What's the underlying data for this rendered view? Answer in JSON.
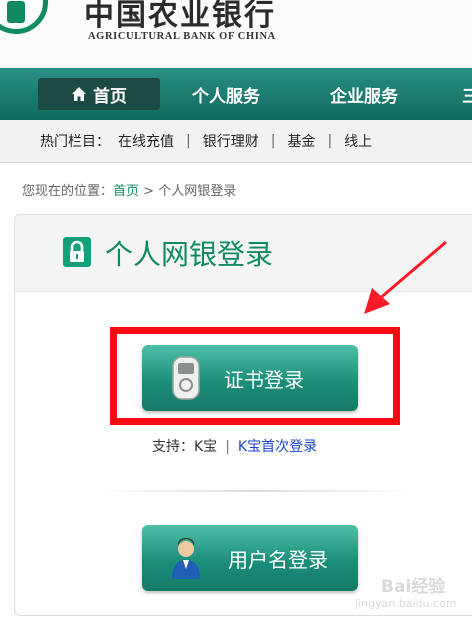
{
  "header": {
    "bank_name_cn": "中国农业银行",
    "bank_name_en": "AGRICULTURAL BANK OF CHINA"
  },
  "nav": {
    "home": "首页",
    "personal": "个人服务",
    "corporate": "企业服务",
    "next_cut": "三"
  },
  "hot_bar": {
    "label": "热门栏目：",
    "links": [
      "在线充值",
      "银行理财",
      "基金",
      "线上"
    ]
  },
  "breadcrumb": {
    "prefix": "您现在的位置：",
    "home": "首页",
    "arrow": ">",
    "current": "个人网银登录"
  },
  "panel": {
    "title": "个人网银登录"
  },
  "cert_login": {
    "label": "证书登录",
    "support_label": "支持：K宝",
    "separator": "|",
    "first_login_link": "K宝首次登录"
  },
  "username_login": {
    "label": "用户名登录"
  },
  "watermark": {
    "line1": "Bai经验",
    "line2": "jingyan.baidu.com"
  },
  "colors": {
    "brand_green": "#0f8a62",
    "nav_green": "#1b7d71",
    "annotation_red": "#ff0b14",
    "link_blue": "#1a45d0"
  },
  "icons": {
    "home": "house-icon",
    "lock": "lock-icon",
    "cert_device": "usb-key-icon",
    "user": "user-icon",
    "annotation": "red-arrow-icon"
  }
}
